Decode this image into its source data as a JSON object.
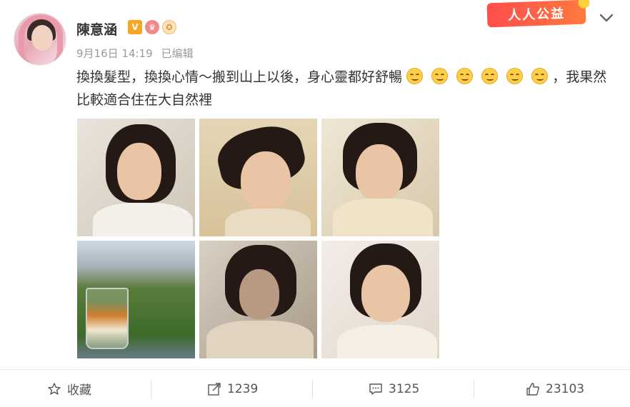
{
  "user": {
    "name": "陳意涵",
    "badges": [
      "V",
      "♛",
      "✪"
    ]
  },
  "meta": {
    "time": "9月16日 14:19",
    "edited": "已编辑"
  },
  "charity_banner": "人人公益",
  "post": {
    "text_part1": "換換髮型，換換心情～搬到山上以後，身心靈都好舒暢",
    "emoji_count": 6,
    "text_part2": "，我果然比較適合住在大自然裡"
  },
  "photos": [
    {
      "name": "photo-1",
      "alt": "portrait smiling chin on hand"
    },
    {
      "name": "photo-2",
      "alt": "hair flip close-up"
    },
    {
      "name": "photo-3",
      "alt": "eyes closed portrait"
    },
    {
      "name": "photo-4",
      "alt": "glass with mountain view"
    },
    {
      "name": "photo-5",
      "alt": "dim lit selfie"
    },
    {
      "name": "photo-6",
      "alt": "smiling bangs portrait"
    }
  ],
  "actions": {
    "favorite_label": "收藏",
    "repost_count": "1239",
    "comment_count": "3125",
    "like_count": "23103"
  },
  "colors": {
    "accent": "#ff5a3c",
    "vip": "#f6a623"
  }
}
